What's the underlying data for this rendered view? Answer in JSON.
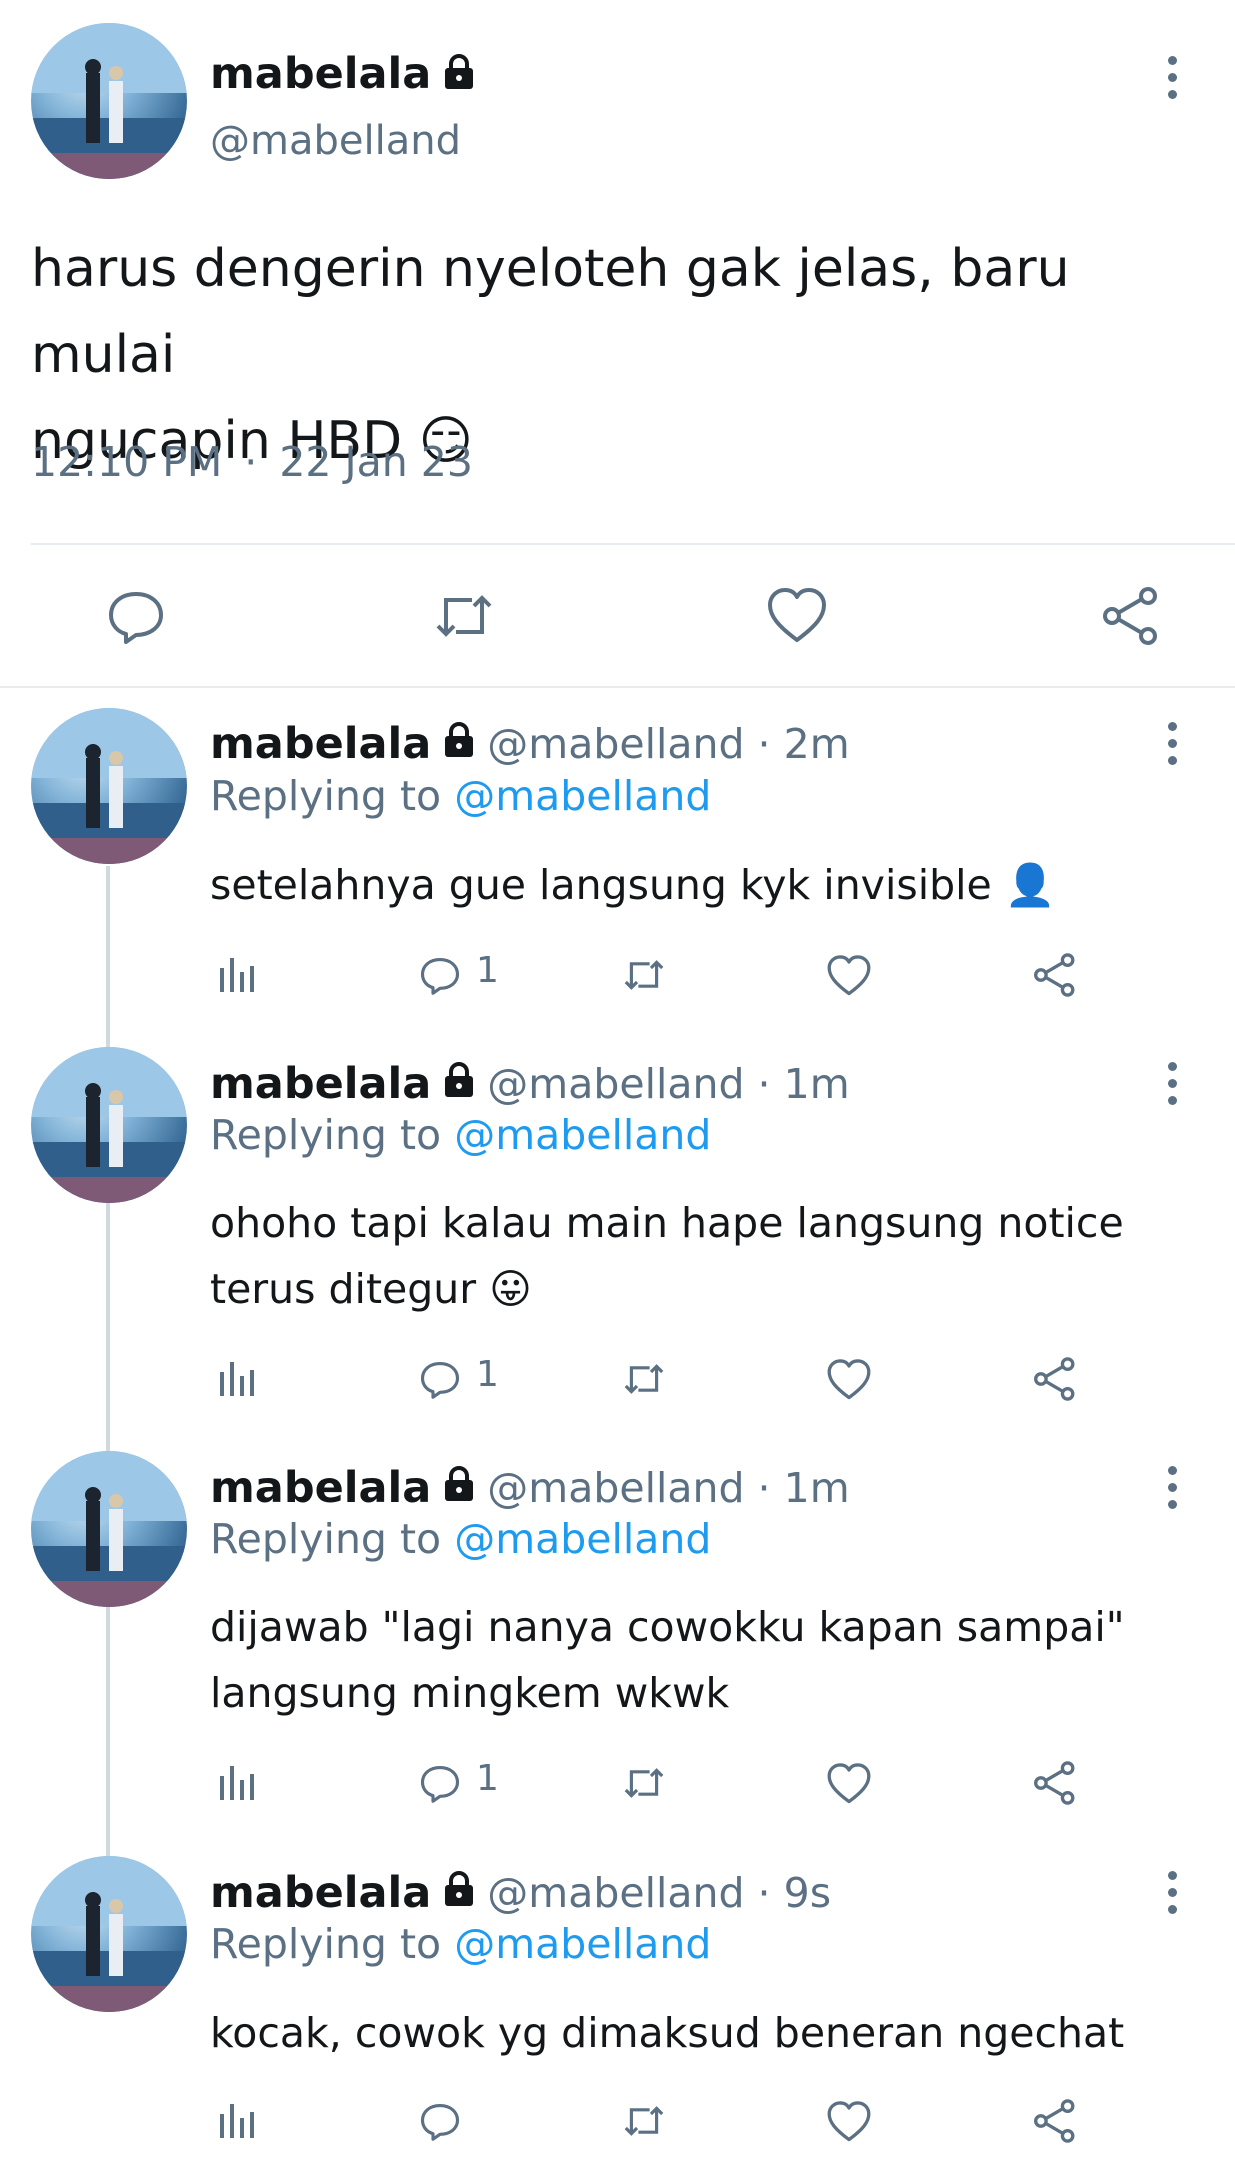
{
  "main_tweet": {
    "display_name": "mabelala",
    "handle": "@mabelland",
    "text_line1": "harus dengerin nyeloteh gak jelas, baru mulai",
    "text_line2": "ngucapin HBD",
    "emoji": "😏",
    "time": "12:10 PM",
    "separator": "·",
    "date": "22 Jan 23"
  },
  "replies": [
    {
      "display_name": "mabelala",
      "handle_time": "@mabelland · 2m",
      "replying_prefix": "Replying to",
      "replying_handle": "@mabelland",
      "text_line1": "setelahnya gue langsung kyk invisible",
      "text_line2": "",
      "emoji": "👤",
      "reply_count": "1"
    },
    {
      "display_name": "mabelala",
      "handle_time": "@mabelland · 1m",
      "replying_prefix": "Replying to",
      "replying_handle": "@mabelland",
      "text_line1": "ohoho tapi kalau main hape langsung notice",
      "text_line2": "terus ditegur",
      "emoji": "😛",
      "reply_count": "1"
    },
    {
      "display_name": "mabelala",
      "handle_time": "@mabelland · 1m",
      "replying_prefix": "Replying to",
      "replying_handle": "@mabelland",
      "text_line1": "dijawab \"lagi nanya cowokku kapan sampai\"",
      "text_line2": "langsung mingkem wkwk",
      "emoji": "",
      "reply_count": "1"
    },
    {
      "display_name": "mabelala",
      "handle_time": "@mabelland · 9s",
      "replying_prefix": "Replying to",
      "replying_handle": "@mabelland",
      "text_line1": "kocak, cowok yg dimaksud beneran ngechat",
      "text_line2": "",
      "emoji": "",
      "reply_count": ""
    }
  ],
  "icons": {
    "lock": "lock-icon",
    "more": "more-vertical-icon",
    "reply": "reply-icon",
    "retweet": "retweet-icon",
    "like": "heart-icon",
    "share": "share-icon",
    "analytics": "analytics-icon"
  },
  "colors": {
    "text": "#14171a",
    "secondary": "#5b7083",
    "accent": "#1d9bf0",
    "divider": "#e6ecf0"
  }
}
